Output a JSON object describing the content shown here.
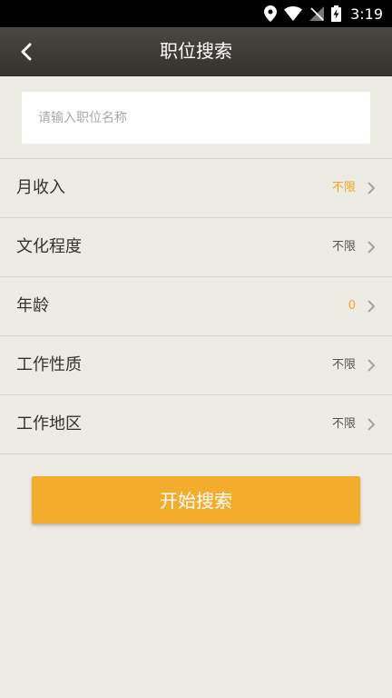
{
  "status_bar": {
    "time": "3:19",
    "icons": [
      "location-icon",
      "wifi-icon",
      "no-sim-icon",
      "battery-charging-icon"
    ]
  },
  "header": {
    "title": "职位搜索",
    "back_icon": "chevron-left-icon"
  },
  "search": {
    "placeholder": "请输入职位名称",
    "value": ""
  },
  "filters": [
    {
      "label": "月收入",
      "value": "不限",
      "accent": true
    },
    {
      "label": "文化程度",
      "value": "不限",
      "accent": false
    },
    {
      "label": "年龄",
      "value": "0",
      "accent": true
    },
    {
      "label": "工作性质",
      "value": "不限",
      "accent": false
    },
    {
      "label": "工作地区",
      "value": "不限",
      "accent": false
    }
  ],
  "actions": {
    "start_search_label": "开始搜索"
  },
  "colors": {
    "accent": "#f3a51c",
    "button": "#f4ac2c",
    "nav_bar": "#3f3c37",
    "background": "#ecebe4"
  }
}
